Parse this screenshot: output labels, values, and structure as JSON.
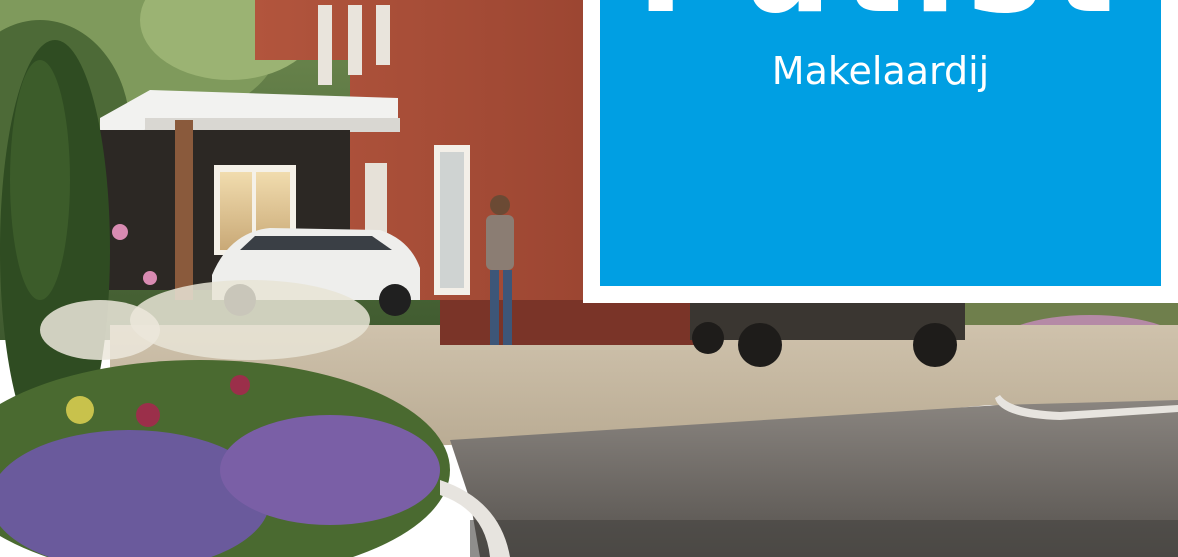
{
  "logo": {
    "name": "Putist",
    "subtitle": "Makelaardij",
    "color": "#009FE3"
  }
}
